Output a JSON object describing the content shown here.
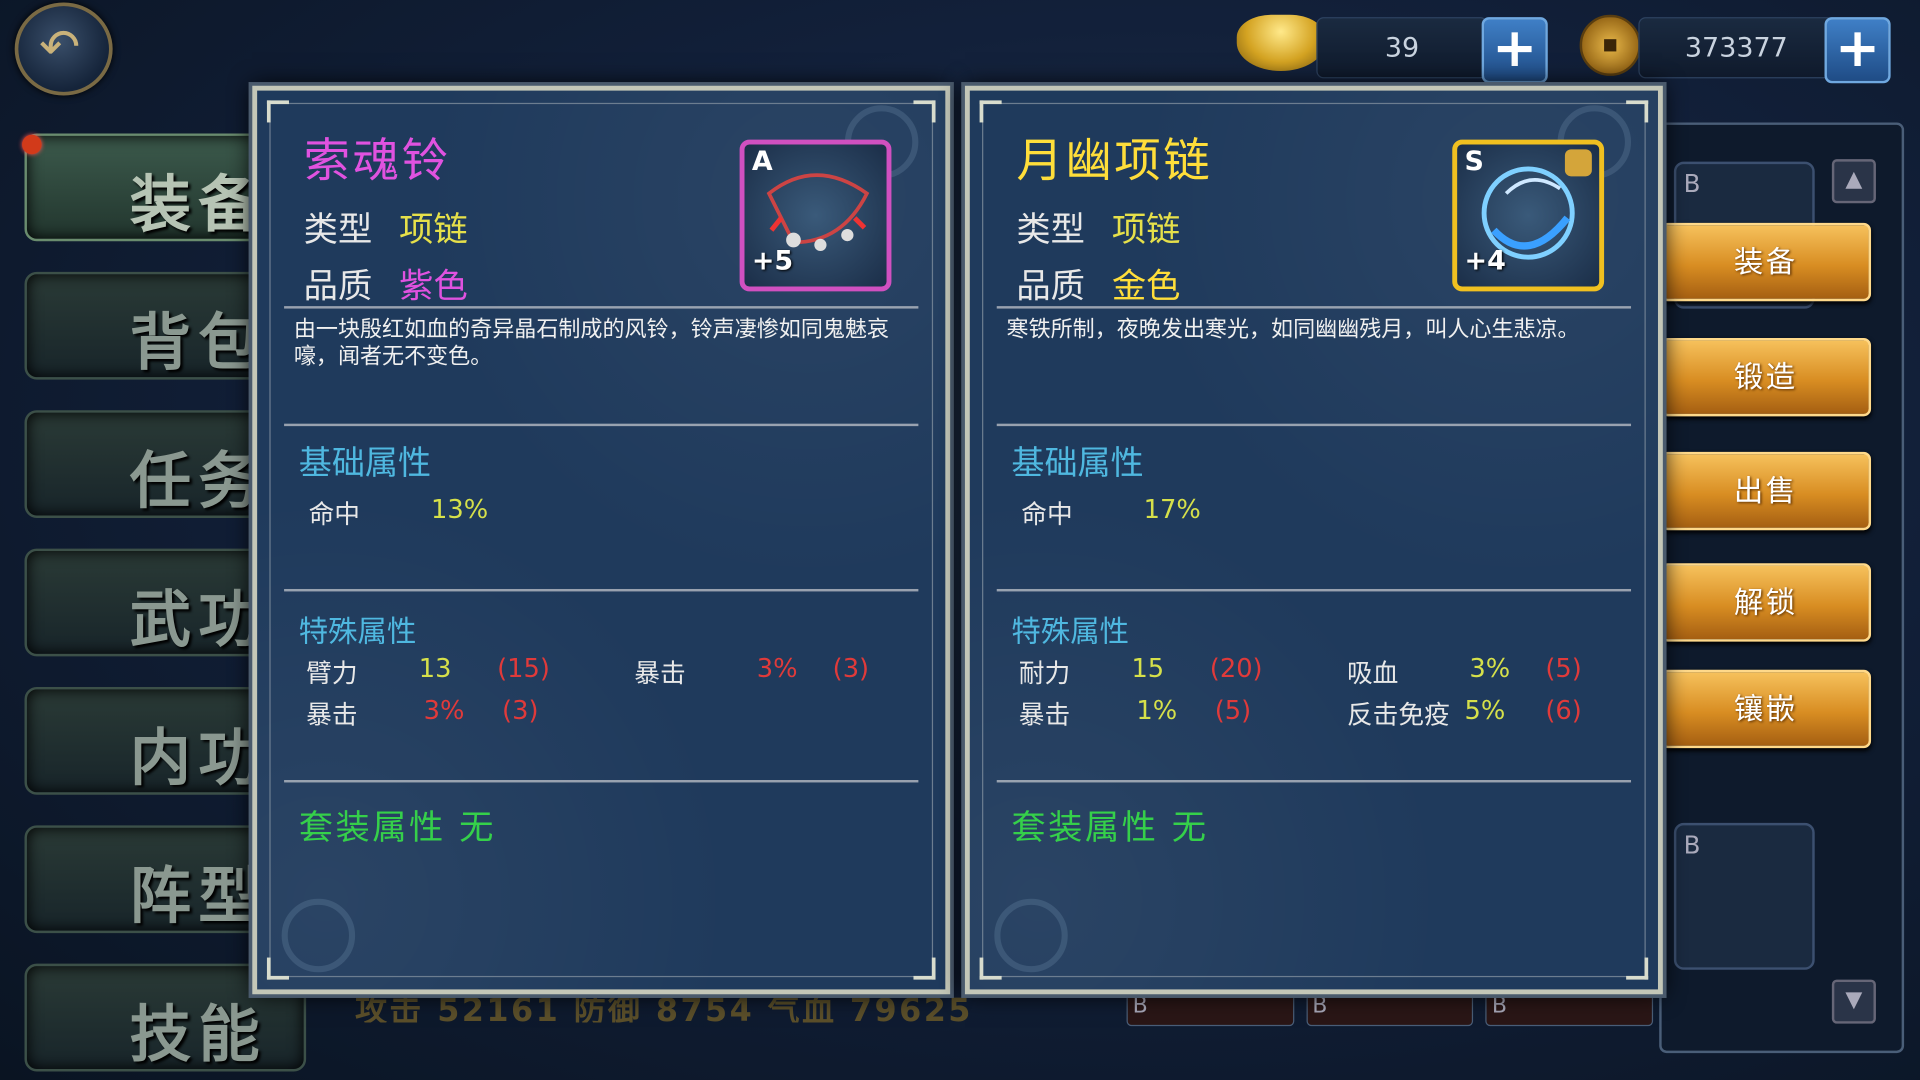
{
  "resources": {
    "ingot_count": "39",
    "coin_count": "373377"
  },
  "nav": {
    "items": [
      "装备",
      "背包",
      "任务",
      "武功",
      "内功",
      "阵型",
      "技能"
    ],
    "active_index": 0
  },
  "actions": [
    "装备",
    "锻造",
    "出售",
    "解锁",
    "镶嵌"
  ],
  "background": {
    "stats_strip": "攻击 52161 防御 8754 气血 79625",
    "inventory_grade": "B"
  },
  "left_item": {
    "name": "索魂铃",
    "type_label": "类型",
    "type_value": "项链",
    "quality_label": "品质",
    "quality_value": "紫色",
    "grade": "A",
    "enhance": "+5",
    "description": "由一块殷红如血的奇异晶石制成的风铃，铃声凄惨如同鬼魅哀嚎，闻者无不变色。",
    "base_title": "基础属性",
    "base_attr": {
      "label": "命中",
      "value": "13%"
    },
    "special_title": "特殊属性",
    "special": [
      {
        "label": "臂力",
        "value": "13",
        "max": "(15)"
      },
      {
        "label": "暴击",
        "value": "3%",
        "max": "(3)"
      },
      {
        "label": "暴击",
        "value": "3%",
        "max": "(3)"
      }
    ],
    "set_title": "套装属性 无",
    "name_color": "#e052e0",
    "border_color": "#d050c0"
  },
  "right_item": {
    "name": "月幽项链",
    "type_label": "类型",
    "type_value": "项链",
    "quality_label": "品质",
    "quality_value": "金色",
    "grade": "S",
    "enhance": "+4",
    "description": "寒铁所制，夜晚发出寒光，如同幽幽残月，叫人心生悲凉。",
    "base_title": "基础属性",
    "base_attr": {
      "label": "命中",
      "value": "17%"
    },
    "special_title": "特殊属性",
    "special": [
      {
        "label": "耐力",
        "value": "15",
        "max": "(20)"
      },
      {
        "label": "吸血",
        "value": "3%",
        "max": "(5)"
      },
      {
        "label": "暴击",
        "value": "1%",
        "max": "(5)"
      },
      {
        "label": "反击免疫",
        "value": "5%",
        "max": "(6)"
      }
    ],
    "set_title": "套装属性 无",
    "name_color": "#ffde3a",
    "border_color": "#f0c020"
  }
}
